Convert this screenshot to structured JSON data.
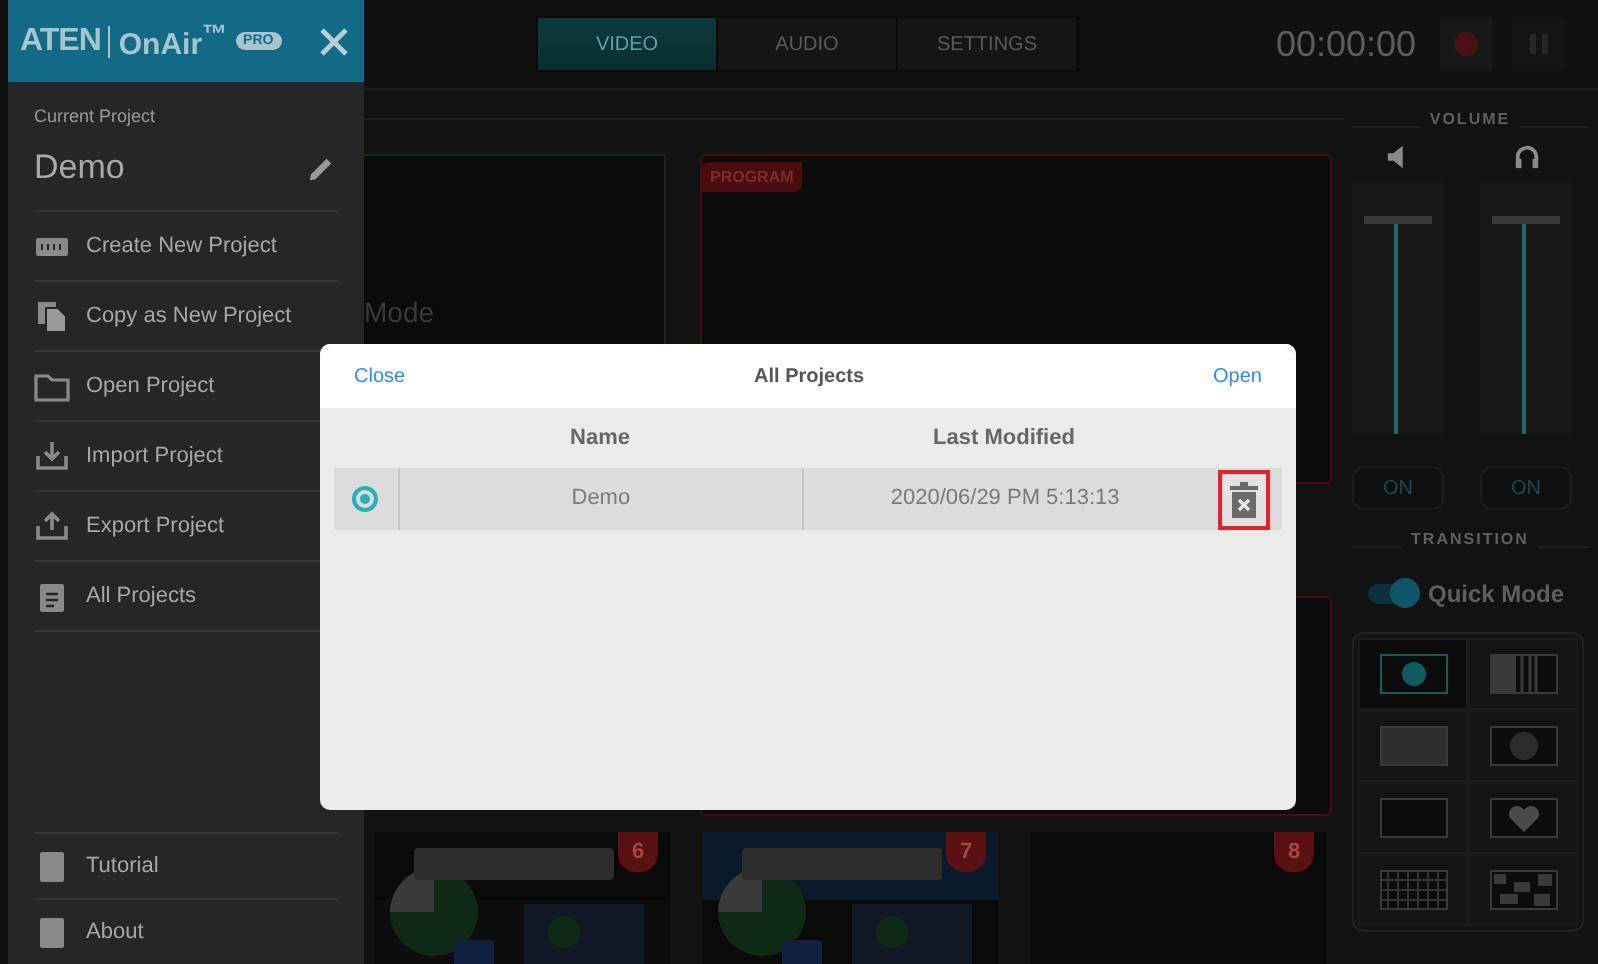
{
  "sidebar": {
    "logo": {
      "brand": "ATEN",
      "product": "OnAir$^{™}$",
      "badge": "PRO"
    },
    "current_project_label": "Current Project",
    "current_project": "Demo",
    "menu": [
      {
        "label": "Create New Project"
      },
      {
        "label": "Copy as New Project"
      },
      {
        "label": "Open Project"
      },
      {
        "label": "Import Project"
      },
      {
        "label": "Export Project"
      },
      {
        "label": "All Projects"
      }
    ],
    "footer_menu": [
      {
        "label": "Tutorial"
      },
      {
        "label": "About"
      }
    ]
  },
  "topbar": {
    "tabs": [
      {
        "label": "VIDEO",
        "selected": true
      },
      {
        "label": "AUDIO",
        "selected": false
      },
      {
        "label": "SETTINGS",
        "selected": false
      }
    ],
    "timer": "00:00:00"
  },
  "preview": {
    "text": "Mode"
  },
  "program": {
    "label": "PROGRAM"
  },
  "sources": [
    {
      "number": "6",
      "kind": "picture"
    },
    {
      "number": "7",
      "kind": "picture"
    },
    {
      "number": "8",
      "kind": "empty"
    }
  ],
  "volume": {
    "title": "VOLUME",
    "channels": [
      {
        "kind": "speaker",
        "level": 0.85,
        "button": "ON"
      },
      {
        "kind": "headphones",
        "level": 0.85,
        "button": "ON"
      }
    ]
  },
  "transition": {
    "title": "TRANSITION",
    "quick_mode": {
      "label": "Quick Mode",
      "on": true
    },
    "effects": [
      {
        "kind": "circle",
        "selected": true
      },
      {
        "kind": "bars",
        "selected": false
      },
      {
        "kind": "dots",
        "selected": false
      },
      {
        "kind": "radial",
        "selected": false
      },
      {
        "kind": "plain",
        "selected": false
      },
      {
        "kind": "heart",
        "selected": false
      },
      {
        "kind": "grid",
        "selected": false
      },
      {
        "kind": "noise",
        "selected": false
      }
    ]
  },
  "dialog": {
    "close": "Close",
    "title": "All Projects",
    "open": "Open",
    "columns": [
      "Name",
      "Last Modified"
    ],
    "rows": [
      {
        "selected": true,
        "name": "Demo",
        "modified": "2020/06/29 PM 5:13:13",
        "delete_highlighted": true
      }
    ]
  }
}
